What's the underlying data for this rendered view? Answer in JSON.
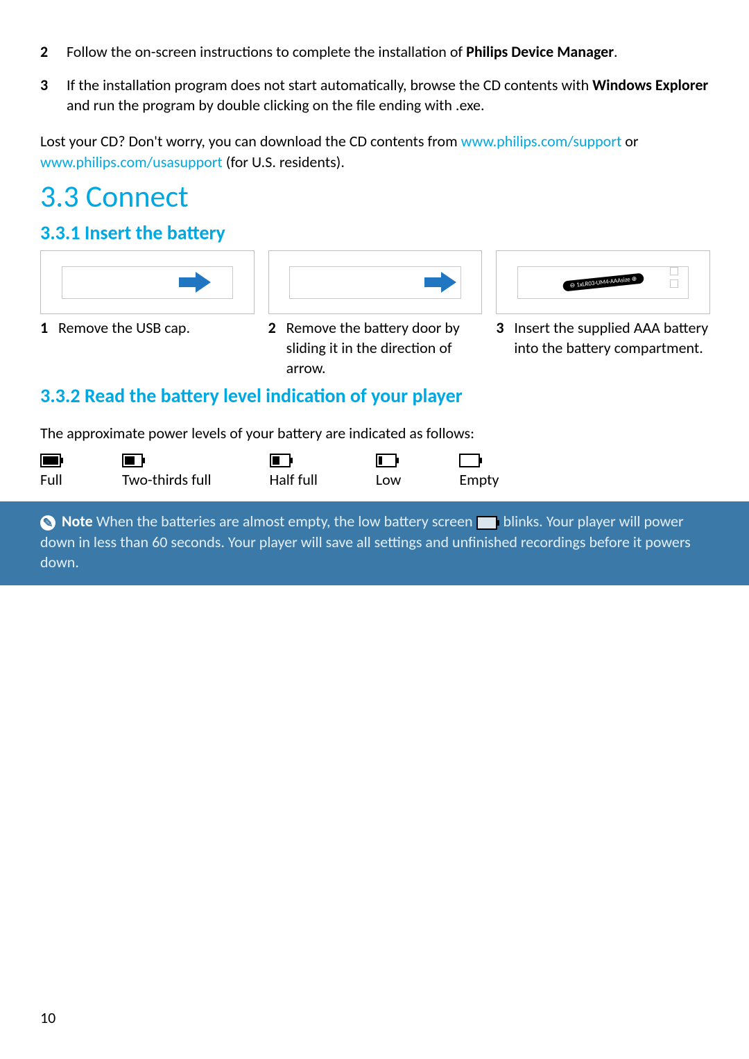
{
  "steps_before": [
    {
      "num": "2",
      "text_pre": "Follow the on-screen instructions to complete the installation of ",
      "bold": "Philips Device Manager",
      "text_post": "."
    },
    {
      "num": "3",
      "text_pre": "If the installation program does not start automatically, browse the CD contents with ",
      "bold": "Windows Explorer",
      "text_post": " and run the program by double clicking on the file ending with .exe."
    }
  ],
  "lost_cd": {
    "pre": "Lost your CD? Don't worry, you can download the CD contents from ",
    "link1": "www.philips.com/support",
    "mid": " or ",
    "link2": "www.philips.com/usasupport",
    "post": " (for U.S. residents)."
  },
  "section": "3.3  Connect",
  "sub1": "3.3.1 Insert the battery",
  "figsteps": [
    {
      "num": "1",
      "text": "Remove the USB cap."
    },
    {
      "num": "2",
      "text": "Remove the battery door by sliding it in the direction of arrow."
    },
    {
      "num": "3",
      "text": "Insert the supplied AAA battery into the battery compartment."
    }
  ],
  "sub2": "3.3.2   Read the battery level indication of your player",
  "levels_intro": "The approximate power levels of your battery are indicated as follows:",
  "levels": [
    {
      "label": "Full"
    },
    {
      "label": "Two-thirds full"
    },
    {
      "label": "Half full"
    },
    {
      "label": "Low"
    },
    {
      "label": "Empty"
    }
  ],
  "note": {
    "label": "Note",
    "text_pre": " When the batteries are almost empty, the low battery screen ",
    "text_post": " blinks. Your player will power down in less than 60 seconds. Your player will save all settings and unfinished recordings before it powers down."
  },
  "battery_graphic_text": "1xLR03·UM4·AAAsize",
  "page_number": "10",
  "chart_data": {
    "type": "table",
    "title": "Battery level indication",
    "categories": [
      "Full",
      "Two-thirds full",
      "Half full",
      "Low",
      "Empty"
    ],
    "values_description": "Each category corresponds to an icon showing decreasing fill of a battery outline; numeric values are not given in the document"
  }
}
